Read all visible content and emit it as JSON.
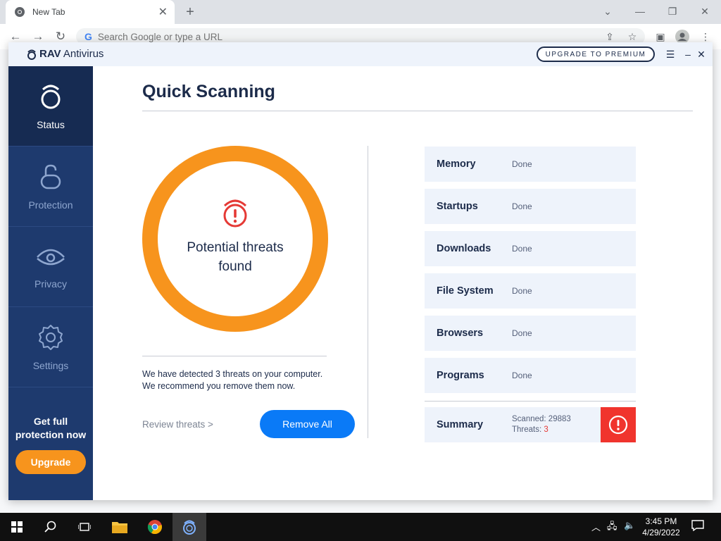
{
  "browser": {
    "tab_title": "New Tab",
    "omnibox_placeholder": "Search Google or type a URL"
  },
  "app": {
    "brand_bold": "RAV",
    "brand_rest": " Antivirus",
    "upgrade_premium": "UPGRADE TO PREMIUM"
  },
  "sidebar": {
    "items": [
      {
        "label": "Status",
        "icon": "status-ring-icon"
      },
      {
        "label": "Protection",
        "icon": "lock-icon"
      },
      {
        "label": "Privacy",
        "icon": "eye-icon"
      },
      {
        "label": "Settings",
        "icon": "gear-icon"
      }
    ],
    "promo_text": "Get full protection now",
    "upgrade_label": "Upgrade"
  },
  "main": {
    "title": "Quick Scanning",
    "ring_text": "Potential threats found",
    "detected_line1": "We have detected 3 threats on your computer.",
    "detected_line2": "We recommend you remove them now.",
    "review_link": "Review threats >",
    "remove_all": "Remove All"
  },
  "scan_items": [
    {
      "name": "Memory",
      "status": "Done"
    },
    {
      "name": "Startups",
      "status": "Done"
    },
    {
      "name": "Downloads",
      "status": "Done"
    },
    {
      "name": "File System",
      "status": "Done"
    },
    {
      "name": "Browsers",
      "status": "Done"
    },
    {
      "name": "Programs",
      "status": "Done"
    }
  ],
  "summary": {
    "label": "Summary",
    "scanned_label": "Scanned: ",
    "scanned_value": "29883",
    "threats_label": "Threats: ",
    "threats_value": "3"
  },
  "taskbar": {
    "time": "3:45 PM",
    "date": "4/29/2022"
  },
  "colors": {
    "sidebar": "#1e3a6e",
    "accent_orange": "#f7941d",
    "button_blue": "#0a7af7",
    "alert_red": "#f0342d"
  }
}
